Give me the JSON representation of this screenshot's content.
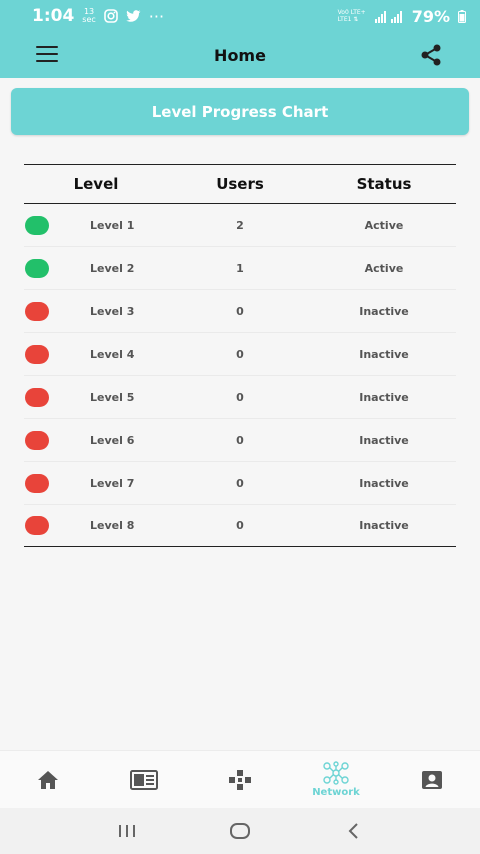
{
  "status_bar": {
    "time": "1:04",
    "notif_count_top": "13",
    "notif_count_bottom": "sec",
    "battery": "79%",
    "dots": "···",
    "network_top": "Vo0 LTE+",
    "network_bottom": "LTE1 ⇅"
  },
  "app_bar": {
    "title": "Home"
  },
  "chart_button": {
    "label": "Level Progress Chart"
  },
  "table": {
    "headers": [
      "Level",
      "Users",
      "Status"
    ],
    "rows": [
      {
        "level": "Level 1",
        "users": "2",
        "status": "Active",
        "color": "#22c06a"
      },
      {
        "level": "Level 2",
        "users": "1",
        "status": "Active",
        "color": "#22c06a"
      },
      {
        "level": "Level 3",
        "users": "0",
        "status": "Inactive",
        "color": "#e8443a"
      },
      {
        "level": "Level 4",
        "users": "0",
        "status": "Inactive",
        "color": "#e8443a"
      },
      {
        "level": "Level 5",
        "users": "0",
        "status": "Inactive",
        "color": "#e8443a"
      },
      {
        "level": "Level 6",
        "users": "0",
        "status": "Inactive",
        "color": "#e8443a"
      },
      {
        "level": "Level 7",
        "users": "0",
        "status": "Inactive",
        "color": "#e8443a"
      },
      {
        "level": "Level 8",
        "users": "0",
        "status": "Inactive",
        "color": "#e8443a"
      }
    ]
  },
  "bottom_nav": {
    "items": [
      {
        "icon": "home-icon",
        "label": ""
      },
      {
        "icon": "news-icon",
        "label": ""
      },
      {
        "icon": "gamepad-icon",
        "label": ""
      },
      {
        "icon": "network-icon",
        "label": "Network"
      },
      {
        "icon": "profile-icon",
        "label": ""
      }
    ]
  },
  "colors": {
    "accent": "#6dd4d4",
    "active": "#22c06a",
    "inactive": "#e8443a"
  }
}
